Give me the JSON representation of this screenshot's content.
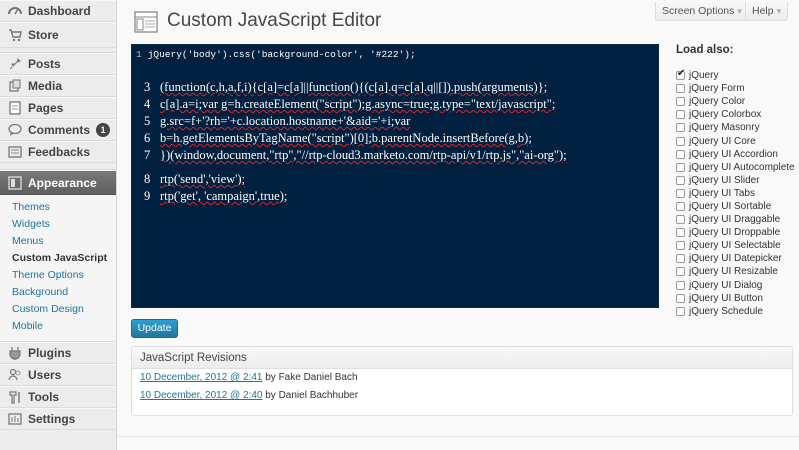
{
  "sidebar": {
    "items": [
      {
        "label": "Dashboard",
        "icon": "dashboard-icon"
      },
      {
        "label": "Store",
        "icon": "cart-icon"
      },
      {
        "label": "Posts",
        "icon": "pin-icon"
      },
      {
        "label": "Media",
        "icon": "media-icon"
      },
      {
        "label": "Pages",
        "icon": "pages-icon"
      },
      {
        "label": "Comments",
        "icon": "comment-icon",
        "badge": "1"
      },
      {
        "label": "Feedbacks",
        "icon": "feedback-icon"
      },
      {
        "label": "Appearance",
        "icon": "appearance-icon"
      },
      {
        "label": "Plugins",
        "icon": "plugin-icon"
      },
      {
        "label": "Users",
        "icon": "users-icon"
      },
      {
        "label": "Tools",
        "icon": "tools-icon"
      },
      {
        "label": "Settings",
        "icon": "settings-icon"
      }
    ],
    "submenu": [
      "Themes",
      "Widgets",
      "Menus",
      "Custom JavaScript",
      "Theme Options",
      "Background",
      "Custom Design",
      "Mobile"
    ]
  },
  "header": {
    "title": "Custom JavaScript Editor",
    "screen_options": "Screen Options",
    "help": "Help"
  },
  "editor": {
    "line1_num": "1",
    "line1_code": "jQuery('body').css('background-color', '#222');",
    "lines": [
      {
        "num": "3",
        "text": "(function(c,h,a,f,i){c[a]=c[a]||function(){(c[a].q=c[a].q||[]).push(arguments)};"
      },
      {
        "num": "4",
        "text": "c[a].a=i;var g=h.createElement(\"script\");g.async=true;g.type=\"text/javascript\";"
      },
      {
        "num": "5",
        "text": "g.src=f+'?rh='+c.location.hostname+'&aid='+i;var"
      },
      {
        "num": "6",
        "text": "b=h.getElementsByTagName(\"script\")[0];b.parentNode.insertBefore(g,b);"
      },
      {
        "num": "7",
        "text": "})(window,document,\"rtp\",\"//rtp-cloud3.marketo.com/rtp-api/v1/rtp.js\",\"ai-org\");"
      },
      {
        "num": "8",
        "text": "rtp('send','view');"
      },
      {
        "num": "9",
        "text": "rtp('get', 'campaign',true);"
      }
    ]
  },
  "load_also": {
    "title": "Load also:",
    "libraries": [
      {
        "label": "jQuery",
        "checked": true
      },
      {
        "label": "jQuery Form",
        "checked": false
      },
      {
        "label": "jQuery Color",
        "checked": false
      },
      {
        "label": "jQuery Colorbox",
        "checked": false
      },
      {
        "label": "jQuery Masonry",
        "checked": false
      },
      {
        "label": "jQuery UI Core",
        "checked": false
      },
      {
        "label": "jQuery UI Accordion",
        "checked": false
      },
      {
        "label": "jQuery UI Autocomplete",
        "checked": false
      },
      {
        "label": "jQuery UI Slider",
        "checked": false
      },
      {
        "label": "jQuery UI Tabs",
        "checked": false
      },
      {
        "label": "jQuery UI Sortable",
        "checked": false
      },
      {
        "label": "jQuery UI Draggable",
        "checked": false
      },
      {
        "label": "jQuery UI Droppable",
        "checked": false
      },
      {
        "label": "jQuery UI Selectable",
        "checked": false
      },
      {
        "label": "jQuery UI Datepicker",
        "checked": false
      },
      {
        "label": "jQuery UI Resizable",
        "checked": false
      },
      {
        "label": "jQuery UI Dialog",
        "checked": false
      },
      {
        "label": "jQuery UI Button",
        "checked": false
      },
      {
        "label": "jQuery Schedule",
        "checked": false
      }
    ]
  },
  "update_label": "Update",
  "revisions": {
    "title": "JavaScript Revisions",
    "items": [
      {
        "link": "10 December, 2012 @ 2:41",
        "by": "by Fake Daniel Bach"
      },
      {
        "link": "10 December, 2012 @ 2:40",
        "by": "by Daniel Bachhuber"
      }
    ]
  }
}
